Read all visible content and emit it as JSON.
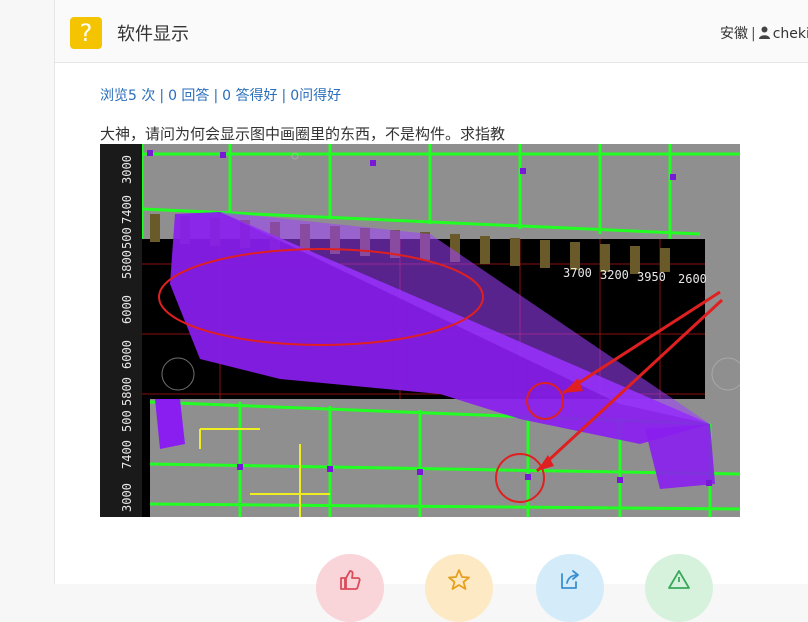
{
  "header": {
    "title": "软件显示",
    "location": "安徽",
    "username": "cheki"
  },
  "stats": {
    "views": "浏览5 次",
    "answers": "0 回答",
    "good_answers": "0 答得好",
    "good_questions": "0问得好"
  },
  "question": {
    "body": "大神，请问为何会显示图中画圈里的东西，不是构件。求指教"
  },
  "screenshot": {
    "dimension_labels_top": [
      "3700",
      "3200",
      "3950",
      "2600"
    ],
    "dimension_labels_left": [
      "3000",
      "7400",
      "500",
      "5800",
      "6000",
      "6000",
      "5800",
      "500",
      "7400",
      "3000"
    ]
  },
  "actions": [
    {
      "name": "like",
      "icon": "thumbs-up-icon"
    },
    {
      "name": "favorite",
      "icon": "star-icon"
    },
    {
      "name": "share",
      "icon": "share-icon"
    },
    {
      "name": "report",
      "icon": "warning-icon"
    }
  ],
  "colors": {
    "logo": "#f5c400",
    "link": "#2a6ebb",
    "annotation_red": "#e02020"
  }
}
